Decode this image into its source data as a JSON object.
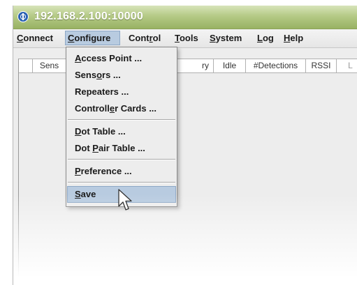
{
  "window": {
    "title": "192.168.2.100:10000",
    "app_icon": "power-circle-icon"
  },
  "menubar": {
    "items": [
      {
        "label": "Connect",
        "mnemonic": "C"
      },
      {
        "label": "Configure",
        "mnemonic": "C",
        "active": true
      },
      {
        "label": "Control",
        "mnemonic": "r"
      },
      {
        "label": "Tools",
        "mnemonic": "T"
      },
      {
        "label": "System",
        "mnemonic": "S"
      },
      {
        "label": "Log",
        "mnemonic": "L"
      },
      {
        "label": "Help",
        "mnemonic": "H"
      }
    ]
  },
  "table": {
    "columns": [
      "",
      "Sens",
      "ry",
      "Idle",
      "#Detections",
      "RSSI",
      "L"
    ]
  },
  "configure_menu": {
    "groups": [
      [
        {
          "label": "Access Point ...",
          "mnemonic": "A"
        },
        {
          "label": "Sensors ...",
          "mnemonic": "o"
        },
        {
          "label": "Repeaters ..."
        },
        {
          "label": "Controller Cards ...",
          "mnemonic": "e"
        }
      ],
      [
        {
          "label": "Dot Table ...",
          "mnemonic": "D"
        },
        {
          "label": "Dot Pair Table ...",
          "mnemonic": "P"
        }
      ],
      [
        {
          "label": "Preference ...",
          "mnemonic": "P"
        }
      ],
      [
        {
          "label": "Save",
          "mnemonic": "S",
          "highlighted": true
        }
      ]
    ]
  },
  "colors": {
    "titlebar": "#a6bd74",
    "highlight": "#b8cbe0",
    "menu_bg": "#ededed"
  },
  "cursor": "arrow-pointer-icon"
}
